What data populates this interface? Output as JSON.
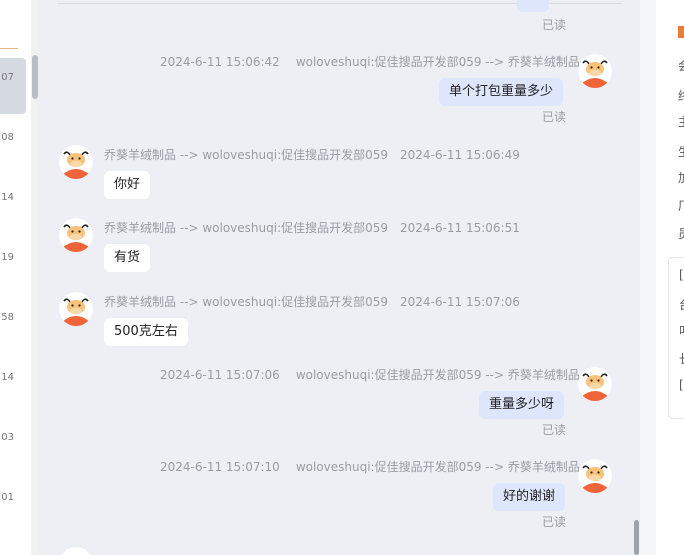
{
  "left_list": {
    "items": [
      {
        "num": "07"
      },
      {
        "num": "08"
      },
      {
        "num": "14"
      },
      {
        "num": "19"
      },
      {
        "num": "58"
      },
      {
        "num": "14"
      },
      {
        "num": "03"
      },
      {
        "num": "01"
      }
    ]
  },
  "chat": {
    "partial_top": {
      "read": "已读"
    },
    "messages": [
      {
        "dir": "out",
        "time": "2024-6-11 15:06:42",
        "route": "woloveshuqi:促佳搜品开发部059 --> 乔葵羊绒制品",
        "text": "单个打包重量多少",
        "read": "已读"
      },
      {
        "dir": "in",
        "time": "2024-6-11 15:06:49",
        "route": "乔葵羊绒制品 --> woloveshuqi:促佳搜品开发部059",
        "text": "你好"
      },
      {
        "dir": "in",
        "time": "2024-6-11 15:06:51",
        "route": "乔葵羊绒制品 --> woloveshuqi:促佳搜品开发部059",
        "text": "有货"
      },
      {
        "dir": "in",
        "time": "2024-6-11 15:07:06",
        "route": "乔葵羊绒制品 --> woloveshuqi:促佳搜品开发部059",
        "text": "500克左右"
      },
      {
        "dir": "out",
        "time": "2024-6-11 15:07:06",
        "route": "woloveshuqi:促佳搜品开发部059 --> 乔葵羊绒制品",
        "text": "重量多少呀",
        "read": "已读"
      },
      {
        "dir": "out",
        "time": "2024-6-11 15:07:10",
        "route": "woloveshuqi:促佳搜品开发部059 --> 乔葵羊绒制品",
        "text": "好的谢谢",
        "read": "已读"
      }
    ]
  },
  "right_panel": {
    "glyphs": [
      "会",
      "终",
      "主",
      "生",
      "加",
      "厂",
      "员"
    ],
    "box_glyphs": [
      "[",
      "台",
      "叫",
      "长",
      "["
    ]
  },
  "colors": {
    "accent": "#f07a3a",
    "bubble_out": "#dde6fb",
    "bubble_in": "#ffffff"
  }
}
